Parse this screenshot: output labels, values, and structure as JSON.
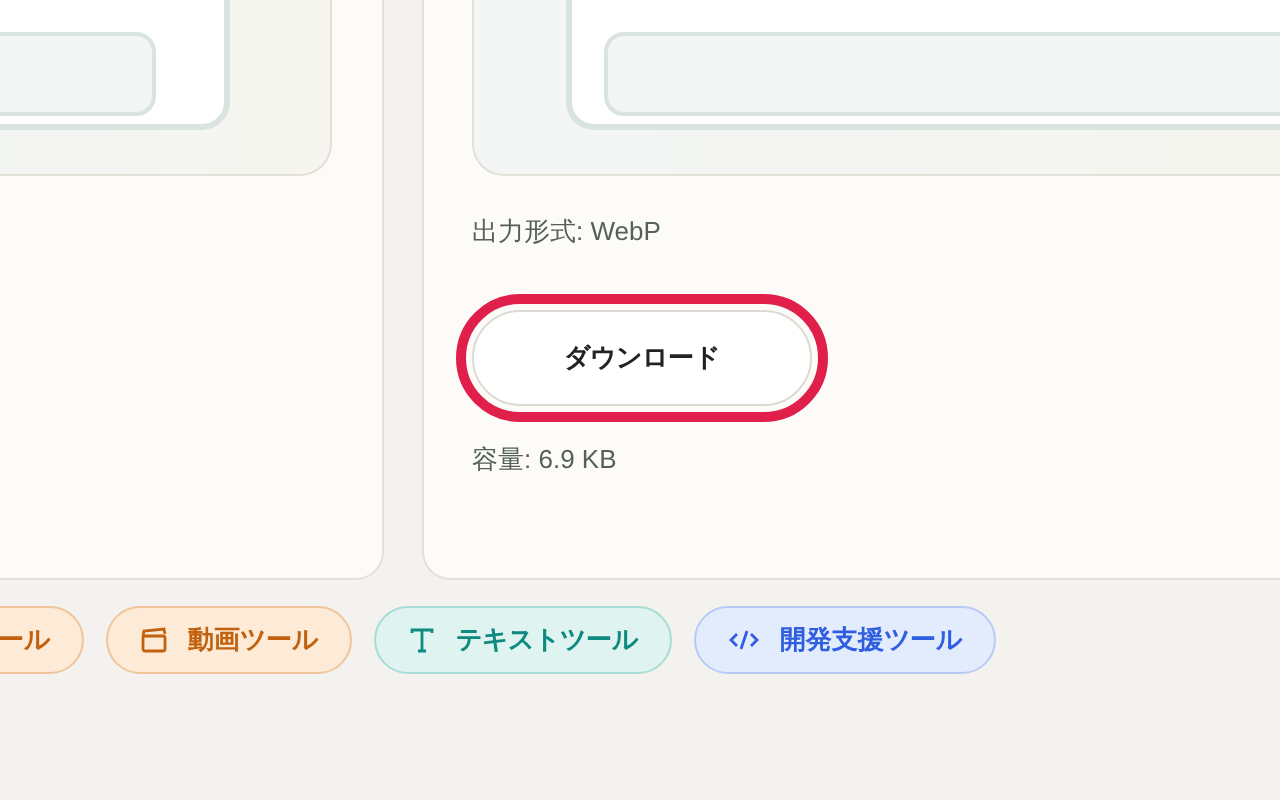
{
  "result_card": {
    "output_format": "出力形式: WebP",
    "download_button": {
      "label": "ダウンロード",
      "highlighted": true
    },
    "file_size": "容量: 6.9 KB"
  },
  "tool_chips": [
    {
      "label": "ール",
      "kind": "none",
      "color": "#c2620f"
    },
    {
      "label": "動画ツール",
      "kind": "video",
      "color": "#c2620f"
    },
    {
      "label": "テキストツール",
      "kind": "text",
      "color": "#0f8a80"
    },
    {
      "label": "開発支援ツール",
      "kind": "code",
      "color": "#2f5fe0"
    }
  ]
}
